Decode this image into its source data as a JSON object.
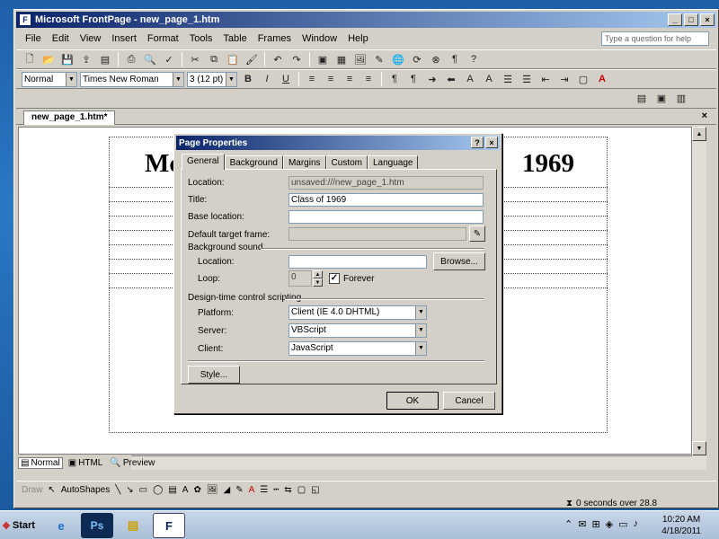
{
  "window": {
    "title": "Microsoft FrontPage - new_page_1.htm",
    "controls": [
      "_",
      "□",
      "×"
    ]
  },
  "menu": {
    "items": [
      "File",
      "Edit",
      "View",
      "Insert",
      "Format",
      "Tools",
      "Table",
      "Frames",
      "Window",
      "Help"
    ],
    "help_placeholder": "Type a question for help"
  },
  "format_toolbar": {
    "style": "Normal",
    "font": "Times New Roman",
    "size": "3  (12 pt)"
  },
  "document": {
    "tab_label": "new_page_1.htm*",
    "heading_left": "Mc",
    "heading_right": "1969"
  },
  "view_tabs": [
    "Normal",
    "HTML",
    "Preview"
  ],
  "drawing_toolbar": {
    "draw_label": "Draw",
    "autoshapes_label": "AutoShapes"
  },
  "status": {
    "download_time": "0 seconds over 28.8"
  },
  "dialog": {
    "title": "Page Properties",
    "tabs": [
      "General",
      "Background",
      "Margins",
      "Custom",
      "Language"
    ],
    "location_label": "Location:",
    "location_value": "unsaved:///new_page_1.htm",
    "title_label": "Title:",
    "title_value": "Class of 1969",
    "base_location_label": "Base location:",
    "default_target_label": "Default target frame:",
    "bg_sound_group": "Background sound",
    "sound_location_label": "Location:",
    "browse_label": "Browse...",
    "loop_label": "Loop:",
    "loop_value": "0",
    "forever_label": "Forever",
    "scripting_group": "Design-time control scripting",
    "platform_label": "Platform:",
    "platform_value": "Client (IE 4.0 DHTML)",
    "server_label": "Server:",
    "server_value": "VBScript",
    "client_label": "Client:",
    "client_value": "JavaScript",
    "style_button": "Style...",
    "ok_button": "OK",
    "cancel_button": "Cancel"
  },
  "taskbar": {
    "start_label": "Start",
    "time": "10:20 AM",
    "date": "4/18/2011"
  }
}
